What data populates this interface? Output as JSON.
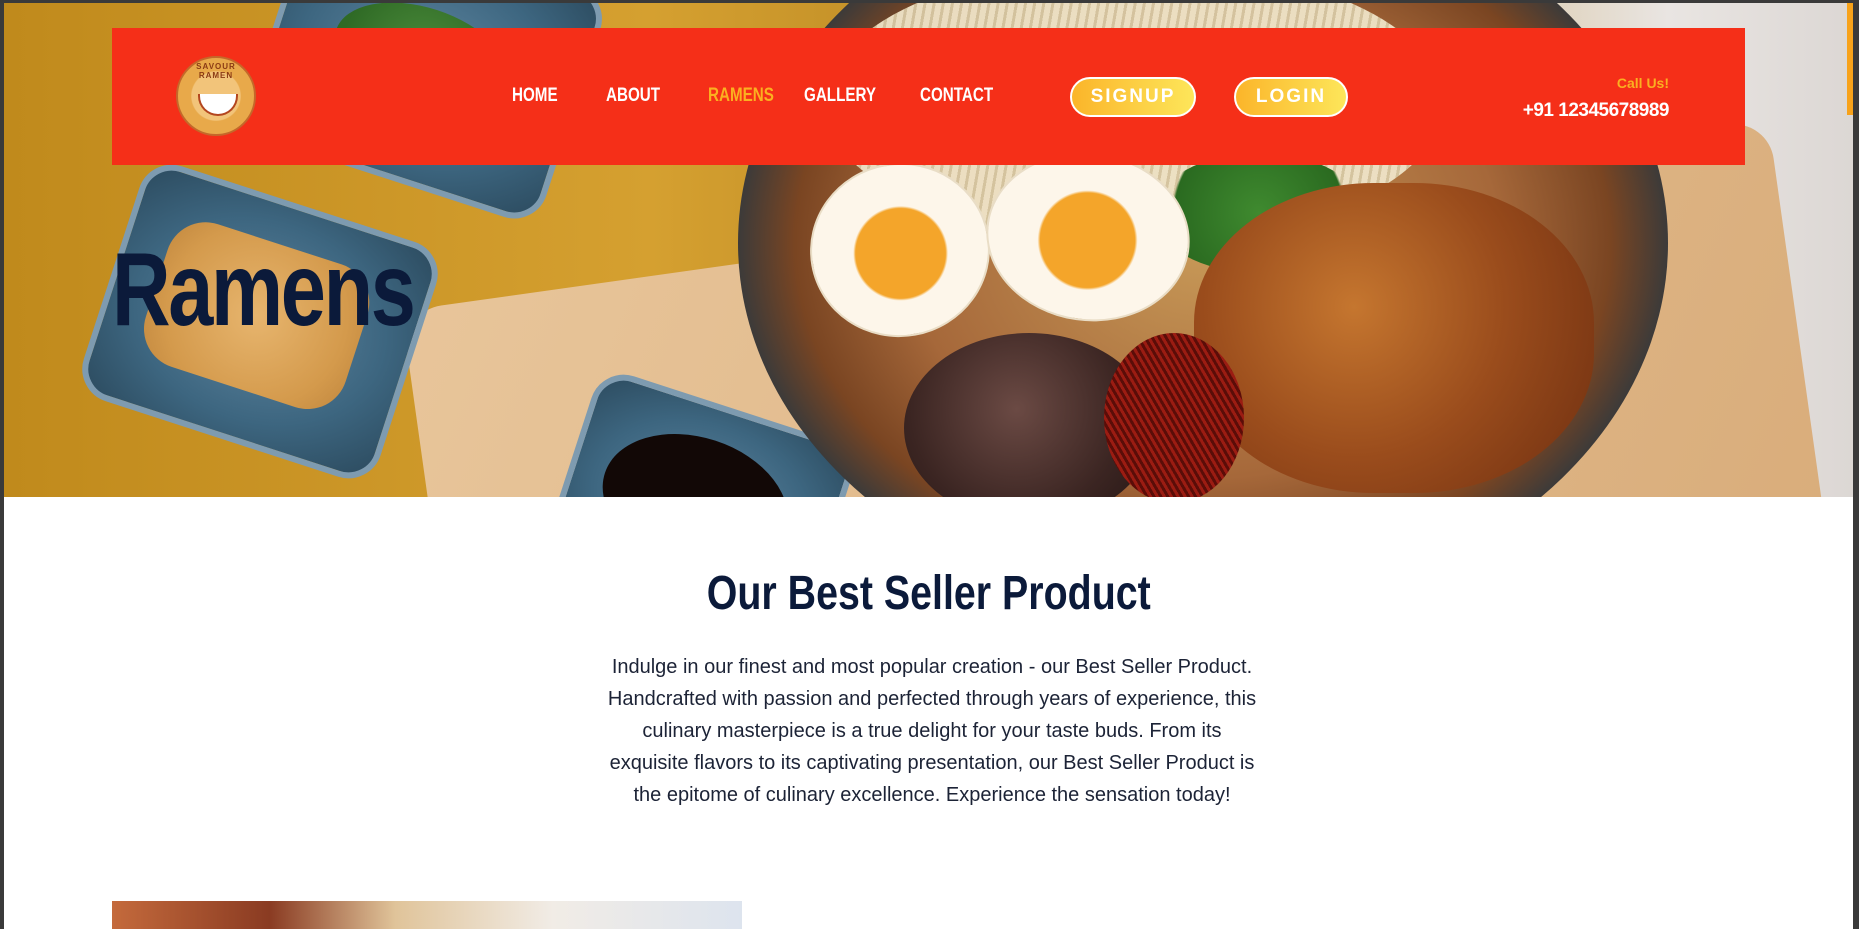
{
  "brand": {
    "logo_text": "SAVOUR RAMEN",
    "logo_icon": "ramen-bowl-icon"
  },
  "nav": {
    "links": [
      {
        "label": "HOME",
        "active": false
      },
      {
        "label": "ABOUT",
        "active": false
      },
      {
        "label": "RAMENS",
        "active": true
      },
      {
        "label": "GALLERY",
        "active": false
      },
      {
        "label": "CONTACT",
        "active": false
      }
    ],
    "signup_label": "SIGNUP",
    "login_label": "LOGIN",
    "call_label": "Call Us!",
    "phone": "+91 12345678989"
  },
  "hero": {
    "title": "Ramens"
  },
  "section": {
    "title": "Our Best Seller Product",
    "description": "Indulge in our finest and most popular creation - our Best Seller Product. Handcrafted with passion and perfected through years of experience, this culinary masterpiece is a true delight for your taste buds. From its exquisite flavors to its captivating presentation, our Best Seller Product is the epitome of culinary excellence. Experience the sensation today!"
  },
  "colors": {
    "navbar": "#f52f18",
    "accent": "#fbb020",
    "heading": "#0b1a3a",
    "button_gradient": [
      "#fbb52a",
      "#fde65a"
    ]
  }
}
